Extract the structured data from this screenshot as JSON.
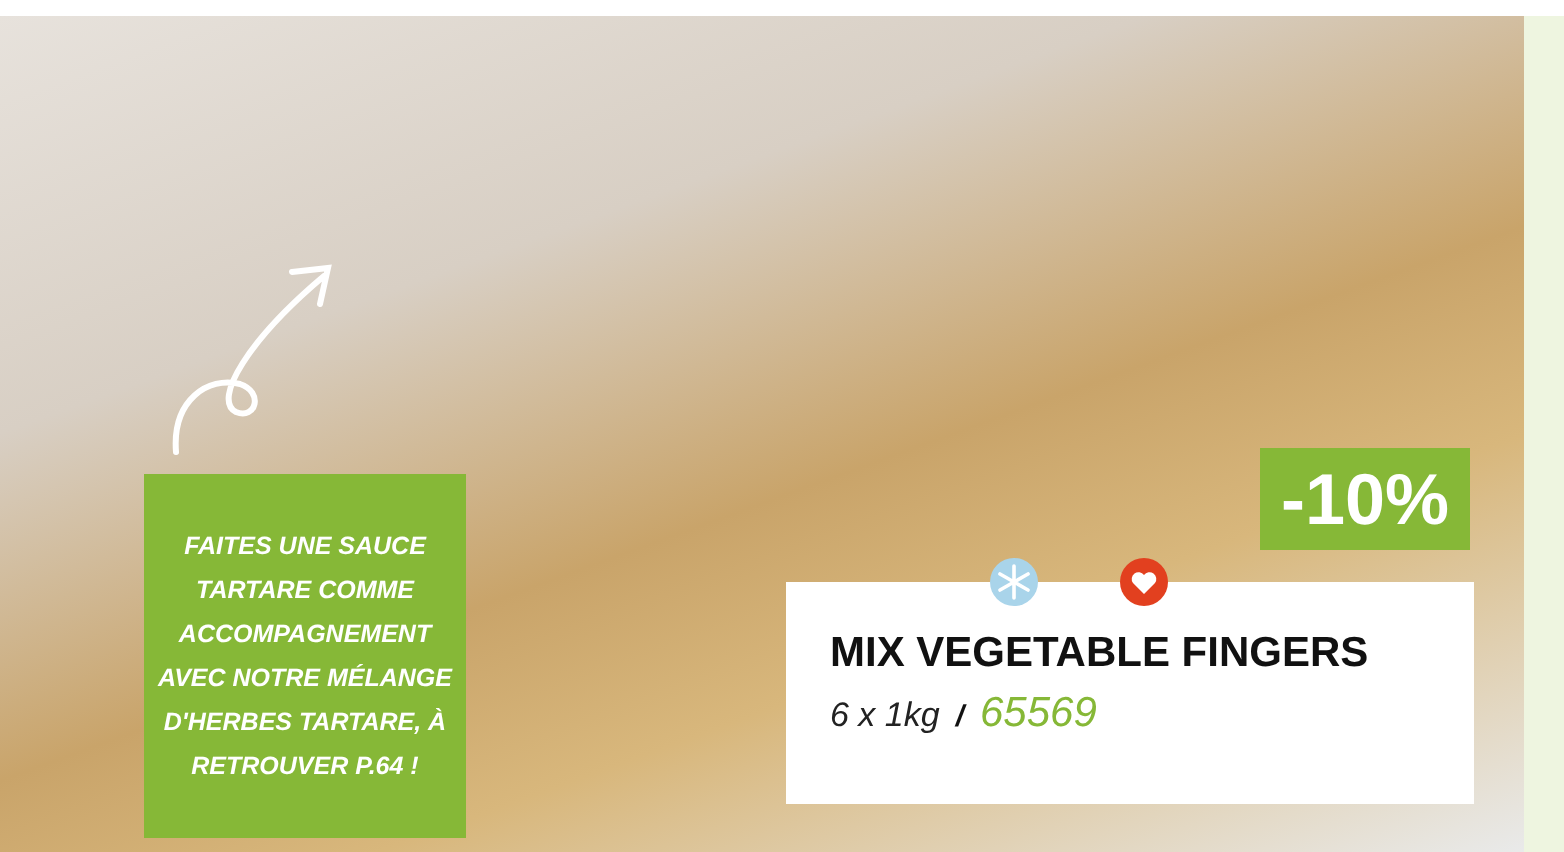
{
  "callout": {
    "text": "FAITES UNE SAUCE TARTARE COMME ACCOMPAGNEMENT AVEC NOTRE MÉLANGE D'HERBES TARTARE, À RETROUVER P.64 !"
  },
  "discount": "-10%",
  "product": {
    "name": "MIX VEGETABLE FINGERS",
    "pack": "6 x 1kg",
    "separator": "/",
    "code": "65569"
  }
}
